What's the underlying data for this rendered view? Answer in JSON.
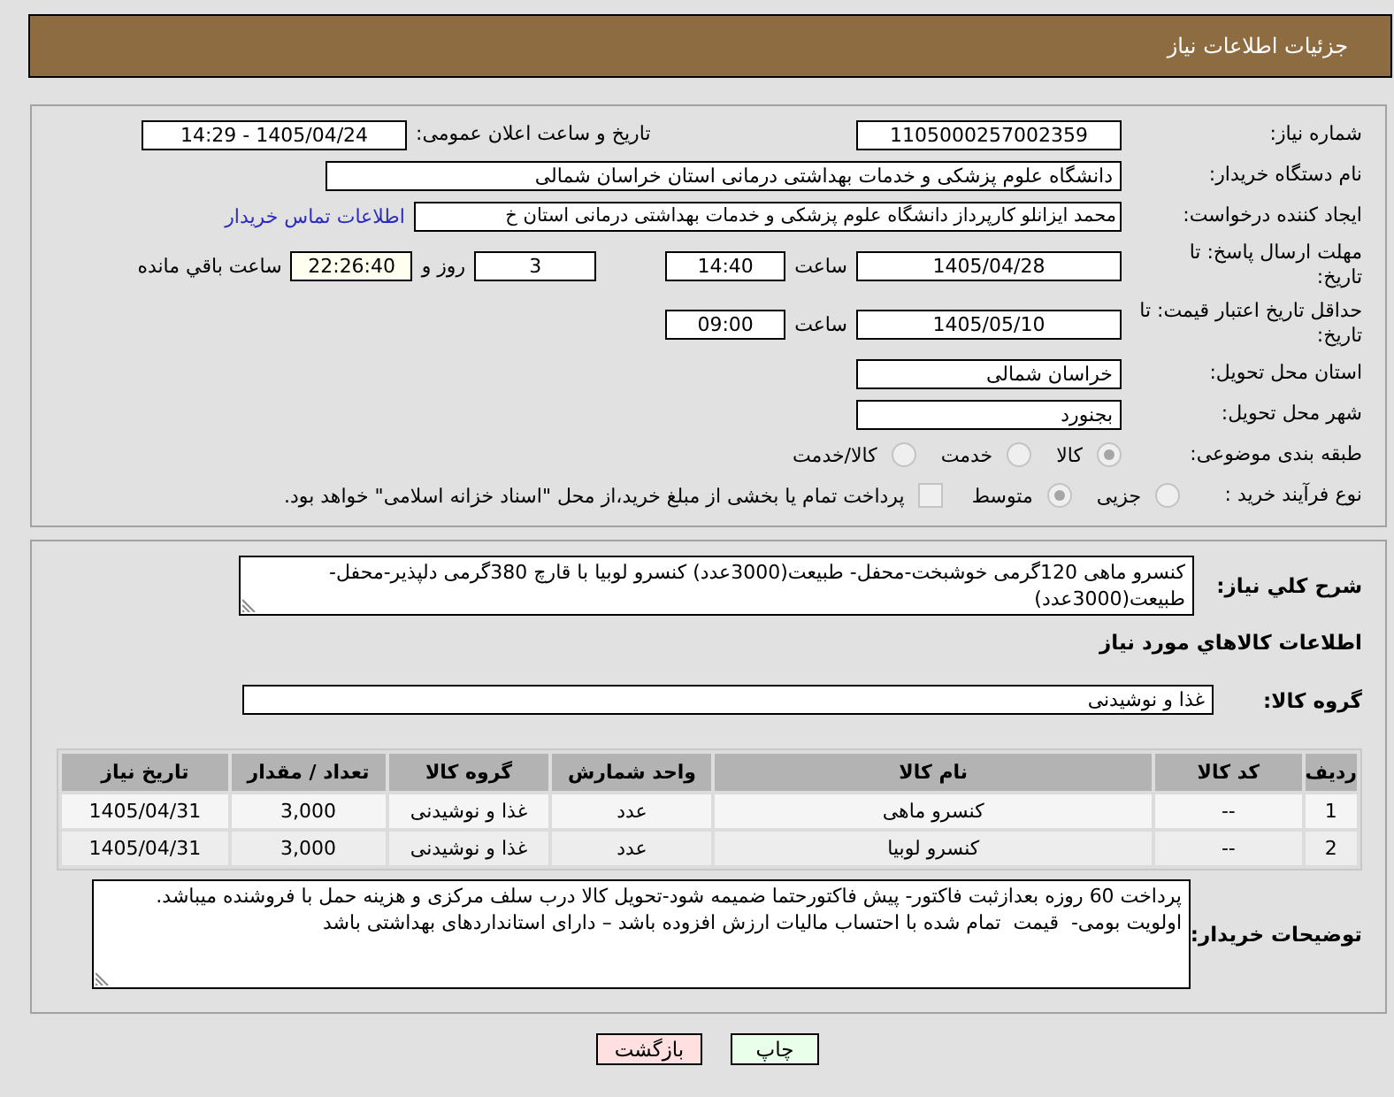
{
  "header": {
    "title": "جزئیات اطلاعات نیاز"
  },
  "need_info": {
    "rows": [
      {
        "kind": "two_fields",
        "label": "شماره نیاز:",
        "value": "1105000257002359",
        "label_2": "تاریخ و ساعت اعلان عمومی:",
        "value_2": "1405/04/24 - 14:29"
      },
      {
        "kind": "wide_field",
        "label": "نام دستگاه خریدار:",
        "value": "دانشگاه علوم پزشکی و خدمات بهداشتی درمانی استان خراسان شمالی"
      },
      {
        "kind": "field_link",
        "label": "ایجاد کننده درخواست:",
        "value": "محمد ایزانلو کارپرداز دانشگاه علوم پزشکی و خدمات بهداشتی درمانی استان خ",
        "link": "اطلاعات تماس خریدار"
      },
      {
        "kind": "date_time",
        "label": "مهلت ارسال پاسخ: تا تاریخ:",
        "date": "1405/04/28",
        "time_label": "ساعت",
        "time": "14:40",
        "countdown": {
          "days": "3",
          "days_label": "روز و",
          "time": "22:26:40",
          "time_label": "ساعت باقي مانده"
        }
      },
      {
        "kind": "date_time",
        "label": "حداقل تاریخ اعتبار قیمت: تا تاریخ:",
        "date": "1405/05/10",
        "time_label": "ساعت",
        "time": "09:00"
      },
      {
        "kind": "field",
        "label": "استان محل تحویل:",
        "value": "خراسان شمالی"
      },
      {
        "kind": "field",
        "label": "شهر محل تحویل:",
        "value": "بجنورد"
      },
      {
        "kind": "radios",
        "label": "طبقه بندی موضوعی:",
        "options": [
          {
            "label": "کالا",
            "selected": true
          },
          {
            "label": "خدمت",
            "selected": false
          },
          {
            "label": "کالا/خدمت",
            "selected": false
          }
        ]
      },
      {
        "kind": "radios",
        "label": "نوع فرآیند خرید :",
        "options": [
          {
            "label": "جزیی",
            "selected": false
          },
          {
            "label": "متوسط",
            "selected": true
          }
        ],
        "checkbox": {
          "label": "پرداخت تمام یا بخشی از مبلغ خرید،از محل \"اسناد خزانه اسلامی\" خواهد بود.",
          "checked": false
        }
      }
    ]
  },
  "need_details": {
    "description": {
      "label": "شرح کلي نیاز:",
      "value": "کنسرو ماهی 120گرمی خوشبخت-محفل- طبیعت(3000عدد) کنسرو لوبیا با قارچ 380گرمی دلپذیر-محفل-طبیعت(3000عدد)"
    },
    "items_title": "اطلاعات کالاهاي مورد نیاز",
    "goods_group": {
      "label": "گروه کالا:",
      "value": "غذا و نوشیدنی"
    },
    "table": {
      "columns": [
        "ردیف",
        "کد کالا",
        "نام کالا",
        "واحد شمارش",
        "گروه کالا",
        "تعداد / مقدار",
        "تاریخ نیاز"
      ],
      "rows": [
        [
          "1",
          "--",
          "کنسرو ماهی",
          "عدد",
          "غذا و نوشیدنی",
          "3,000",
          "1405/04/31"
        ],
        [
          "2",
          "--",
          "کنسرو لوبیا",
          "عدد",
          "غذا و نوشیدنی",
          "3,000",
          "1405/04/31"
        ]
      ]
    },
    "buyer_notes": {
      "label": "توضیحات خریدار:",
      "value": "پرداخت 60 روزه بعدازثبت فاکتور- پیش فاکتورحتما ضمیمه شود-تحویل کالا درب سلف مرکزی و هزینه حمل با فروشنده میباشد. اولویت بومی-  قیمت  تمام شده با احتساب مالیات ارزش افزوده باشد – دارای استانداردهای بهداشتی باشد"
    }
  },
  "buttons": [
    {
      "kind": "print",
      "label": "چاپ"
    },
    {
      "kind": "back",
      "label": "بازگشت"
    }
  ]
}
